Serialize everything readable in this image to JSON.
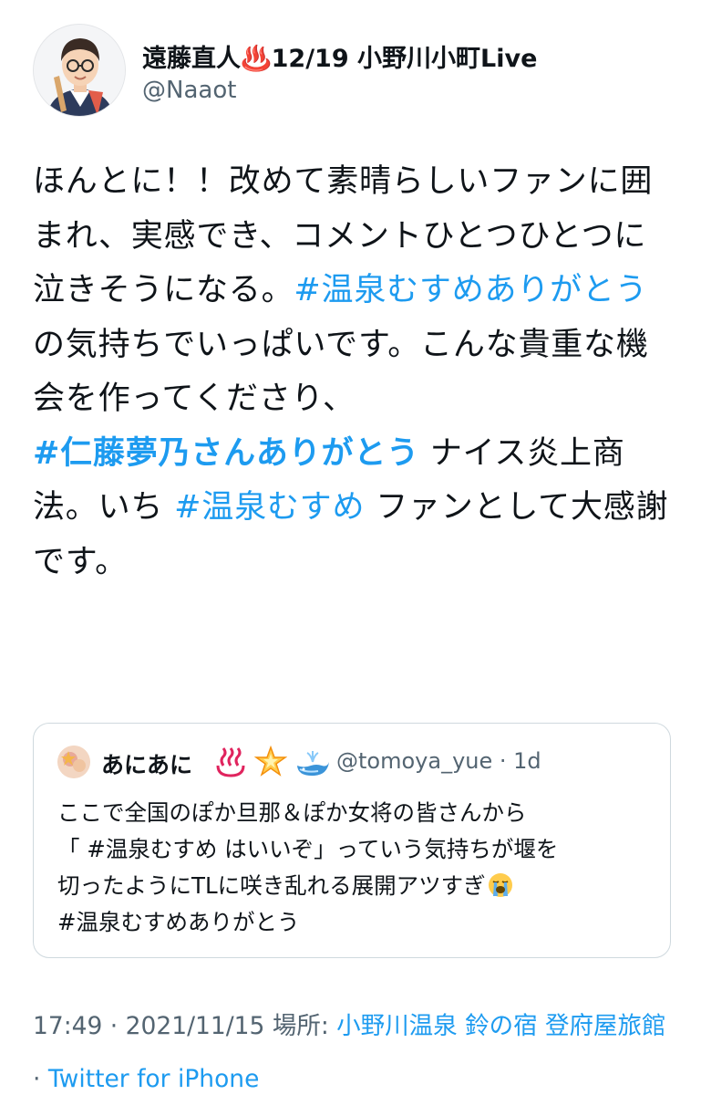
{
  "author": {
    "display_name": "遠藤直人♨️12/19 小野川小町Live",
    "handle": "@Naaot",
    "avatar_icon": "illustrated-portrait-avatar"
  },
  "tweet": {
    "text_1": "ほんとに！！改めて素晴らしいファンに囲まれ、実感でき、コメントひとつひとつに泣きそうになる。",
    "hashtag_1": "#温泉むすめありがとう",
    "text_2": " の気持ちでいっぱいです。こんな貴重な機会を作ってくださり、",
    "hashtag_2": "#仁藤夢乃さんありがとう",
    "text_3": " ナイス炎上商法。いち ",
    "hashtag_3": "#温泉むすめ",
    "text_4": " ファンとして大感謝です。"
  },
  "quote": {
    "name": "あにあに",
    "emojis": [
      "hot-springs-emoji",
      "glowing-star-emoji",
      "spouting-whale-emoji"
    ],
    "handle": "@tomoya_yue · 1d",
    "line_1": "ここで全国のぽか旦那＆ぽか女将の皆さんから",
    "line_2": "「 #温泉むすめ はいいぞ」っていう気持ちが堰を",
    "line_3": "切ったようにTLに咲き乱れる展開アツすぎ",
    "line_3_emoji": "loudly-crying-face-emoji",
    "line_4": "#温泉むすめありがとう"
  },
  "meta": {
    "time": "17:49 · 2021/11/15",
    "place_label": " 場所: ",
    "place": "小野川温泉 鈴の宿 登府屋旅館",
    "separator": " · ",
    "source": "Twitter for iPhone"
  },
  "colors": {
    "link": "#1d9bf0",
    "text": "#0f1419",
    "secondary": "#536471",
    "border": "#cfd9de"
  }
}
